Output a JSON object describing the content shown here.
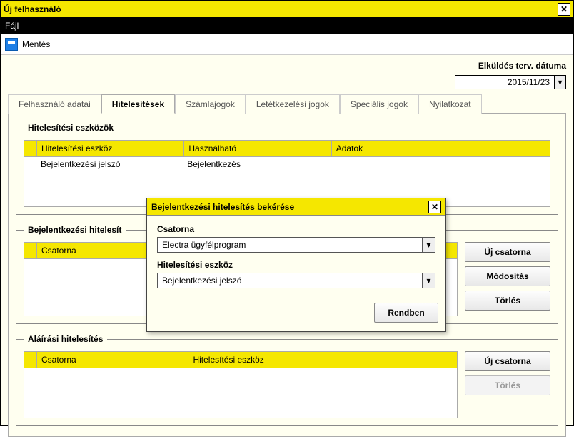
{
  "window": {
    "title": "Új felhasználó"
  },
  "menu": {
    "file": "Fájl"
  },
  "toolbar": {
    "save": "Mentés"
  },
  "header": {
    "date_label": "Elküldés terv. dátuma",
    "date_value": "2015/11/23"
  },
  "tabs": {
    "t0": "Felhasználó adatai",
    "t1": "Hitelesítések",
    "t2": "Számlajogok",
    "t3": "Letétkezelési jogok",
    "t4": "Speciális jogok",
    "t5": "Nyilatkozat",
    "active": "t1"
  },
  "sections": {
    "tools": {
      "legend": "Hitelesítési eszközök",
      "col_narrow": "",
      "col_tool": "Hitelesítési eszköz",
      "col_usable": "Használható",
      "col_data": "Adatok",
      "row0_tool": "Bejelentkezési jelszó",
      "row0_usable": "Bejelentkezés"
    },
    "login": {
      "legend": "Bejelentkezési hitelesít",
      "col_narrow": "",
      "col_channel": "Csatorna",
      "btn_new": "Új csatorna",
      "btn_mod": "Módosítás",
      "btn_del": "Törlés"
    },
    "sign": {
      "legend": "Aláírási hitelesítés",
      "col_narrow": "",
      "col_channel": "Csatorna",
      "col_tool": "Hitelesítési eszköz",
      "btn_new": "Új csatorna",
      "btn_del": "Törlés"
    }
  },
  "dialog": {
    "title": "Bejelentkezési hitelesítés bekérése",
    "field_channel_label": "Csatorna",
    "field_channel_value": "Electra ügyfélprogram",
    "field_tool_label": "Hitelesítési eszköz",
    "field_tool_value": "Bejelentkezési jelszó",
    "ok": "Rendben"
  }
}
